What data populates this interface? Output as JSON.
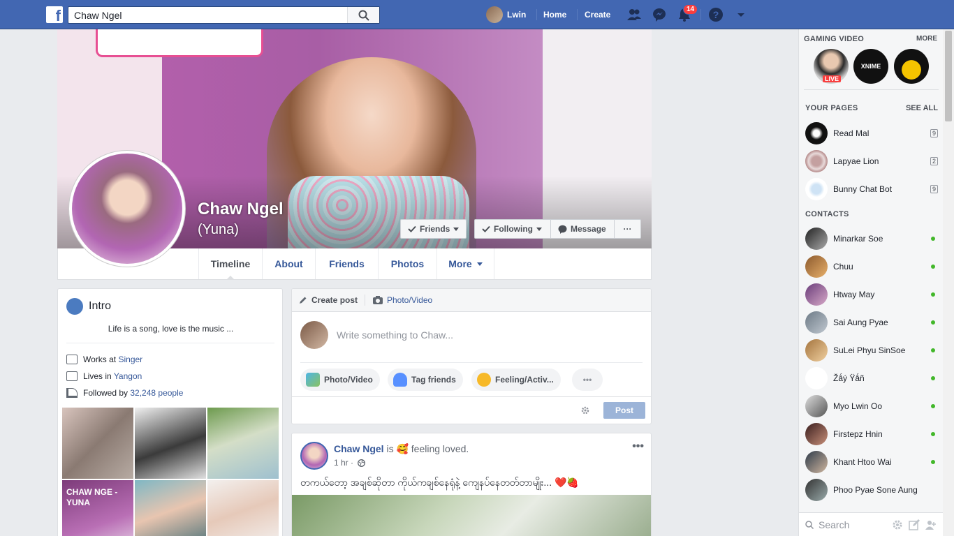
{
  "topbar": {
    "search_value": "Chaw Ngel",
    "user_name": "Lwin",
    "home_label": "Home",
    "create_label": "Create",
    "notif_count": "14"
  },
  "profile": {
    "name": "Chaw Ngel",
    "alt_name": "(Yuna)",
    "friends_btn": "Friends",
    "following_btn": "Following",
    "message_btn": "Message",
    "more_btn": "···"
  },
  "tabs": [
    "Timeline",
    "About",
    "Friends",
    "Photos",
    "More"
  ],
  "intro": {
    "title": "Intro",
    "bio": "Life is a song, love is the music ...",
    "works_prefix": "Works at ",
    "works_link": "Singer",
    "lives_prefix": "Lives in ",
    "lives_link": "Yangon",
    "followed_prefix": "Followed by ",
    "followed_link": "32,248 people",
    "photo_caption": "CHAW NGE - YUNA"
  },
  "composer": {
    "create_post": "Create post",
    "photo_video": "Photo/Video",
    "placeholder": "Write something to Chaw...",
    "pill_photo": "Photo/Video",
    "pill_tag": "Tag friends",
    "pill_feeling": "Feeling/Activ...",
    "pill_more": "•••",
    "post_btn": "Post"
  },
  "post": {
    "author": "Chaw Ngel",
    "activity": " is 🥰 feeling loved.",
    "time": "1 hr · ",
    "text": "တကယ်တော့ အချစ်ဆိုတာ ကိုယ်ကချစ်နေရုံနဲ့ ကျေနပ်နေတတ်တာမျိုး... ❤️🍓",
    "dots": "•••"
  },
  "sidebar": {
    "gaming_title": "GAMING VIDEO",
    "gaming_more": "MORE",
    "live_tag": "LIVE",
    "pages_title": "YOUR PAGES",
    "pages_see_all": "SEE ALL",
    "pages": [
      {
        "name": "Read Mal",
        "count": "9"
      },
      {
        "name": "Lapyae Lion",
        "count": "2"
      },
      {
        "name": "Bunny Chat Bot",
        "count": "9"
      }
    ],
    "contacts_title": "CONTACTS",
    "contacts": [
      "Minarkar Soe",
      "Chuu",
      "Htway May",
      "Sai Aung Pyae",
      "SuLei Phyu SinSoe",
      "Žǻý Ÿǻñ",
      "Myo Lwin Oo",
      "Firstepz Hnin",
      "Khant Htoo Wai",
      "Phoo Pyae Sone Aung"
    ],
    "search_placeholder": "Search"
  },
  "colors": {
    "brand": "#4267b2",
    "link": "#365899",
    "online": "#42b72a",
    "badge": "#fa3e3e"
  }
}
